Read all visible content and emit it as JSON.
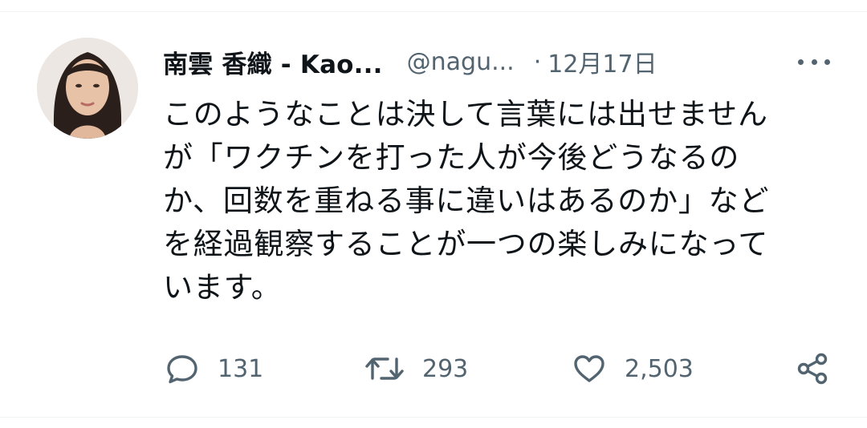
{
  "tweet": {
    "author": {
      "display_name": "南雲 香織 - Kao...",
      "handle": "@nagu...",
      "avatar": "avatar"
    },
    "separator": "·",
    "date": "12月17日",
    "text_lines": [
      "このようなことは決して言葉には出せません",
      "が「ワクチンを打った人が今後どうなるの",
      "か、回数を重ねる事に違いはあるのか」など",
      "を経過観察することが一つの楽しみになって",
      "います。"
    ],
    "actions": {
      "reply_count": "131",
      "retweet_count": "293",
      "like_count": "2,503"
    },
    "icons": {
      "reply": "speech-bubble-icon",
      "retweet": "retweet-icon",
      "like": "heart-icon",
      "share": "share-icon",
      "more": "more-dots-icon"
    },
    "colors": {
      "text": "#0f1419",
      "secondary": "#536471",
      "divider": "#eff3f4"
    }
  }
}
